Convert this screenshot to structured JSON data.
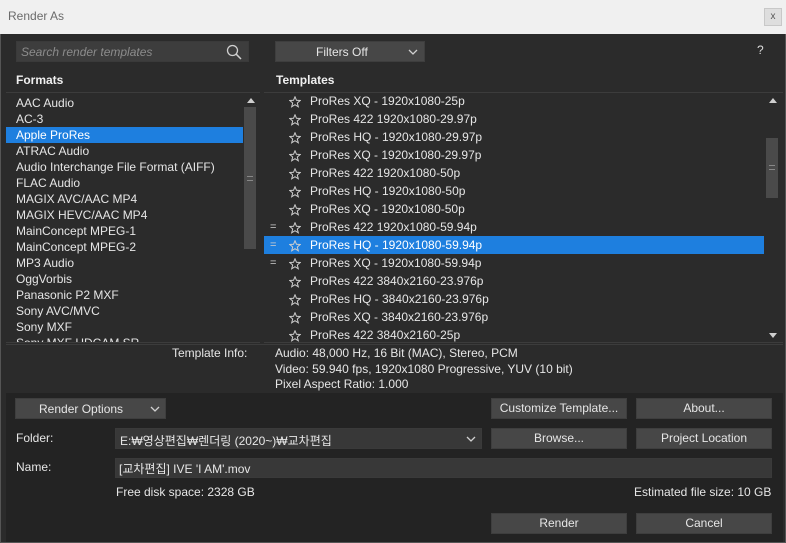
{
  "window": {
    "title": "Render As",
    "close_label": "x"
  },
  "search": {
    "placeholder": "Search render templates"
  },
  "filter": {
    "label": "Filters Off"
  },
  "help": {
    "label": "?"
  },
  "formats": {
    "header": "Formats",
    "items": [
      "AAC Audio",
      "AC-3",
      "Apple ProRes",
      "ATRAC Audio",
      "Audio Interchange File Format (AIFF)",
      "FLAC Audio",
      "MAGIX AVC/AAC MP4",
      "MAGIX HEVC/AAC MP4",
      "MainConcept MPEG-1",
      "MainConcept MPEG-2",
      "MP3 Audio",
      "OggVorbis",
      "Panasonic P2 MXF",
      "Sony AVC/MVC",
      "Sony MXF",
      "Sony MXF HDCAM SR"
    ],
    "selected_index": 2
  },
  "templates": {
    "header": "Templates",
    "items": [
      {
        "name": "ProRes XQ - 1920x1080-25p",
        "marker": ""
      },
      {
        "name": "ProRes 422 1920x1080-29.97p",
        "marker": ""
      },
      {
        "name": "ProRes HQ - 1920x1080-29.97p",
        "marker": ""
      },
      {
        "name": "ProRes XQ - 1920x1080-29.97p",
        "marker": ""
      },
      {
        "name": "ProRes 422 1920x1080-50p",
        "marker": ""
      },
      {
        "name": "ProRes HQ - 1920x1080-50p",
        "marker": ""
      },
      {
        "name": "ProRes XQ - 1920x1080-50p",
        "marker": ""
      },
      {
        "name": "ProRes 422 1920x1080-59.94p",
        "marker": "="
      },
      {
        "name": "ProRes HQ - 1920x1080-59.94p",
        "marker": "="
      },
      {
        "name": "ProRes XQ - 1920x1080-59.94p",
        "marker": "="
      },
      {
        "name": "ProRes 422 3840x2160-23.976p",
        "marker": ""
      },
      {
        "name": "ProRes HQ - 3840x2160-23.976p",
        "marker": ""
      },
      {
        "name": "ProRes XQ - 3840x2160-23.976p",
        "marker": ""
      },
      {
        "name": "ProRes 422 3840x2160-25p",
        "marker": ""
      }
    ],
    "selected_index": 8
  },
  "template_info": {
    "label": "Template Info:",
    "audio": "Audio: 48,000 Hz, 16 Bit (MAC), Stereo, PCM",
    "video": "Video: 59.940 fps, 1920x1080 Progressive, YUV (10 bit)",
    "par": "Pixel Aspect Ratio: 1.000"
  },
  "buttons": {
    "render_options": "Render Options",
    "customize": "Customize Template...",
    "about": "About...",
    "browse": "Browse...",
    "project_location": "Project Location",
    "render": "Render",
    "cancel": "Cancel"
  },
  "folder": {
    "label": "Folder:",
    "value": "E:₩영상편집₩렌더링 (2020~)₩교차편집"
  },
  "name": {
    "label": "Name:",
    "value": "[교차편집] IVE 'I AM'.mov"
  },
  "disk": {
    "free": "Free disk space: 2328 GB",
    "estimated": "Estimated file size: 10 GB"
  },
  "icons": {
    "search": "search-icon",
    "chevron": "chevron-down-icon",
    "star": "star-outline-icon",
    "close": "close-icon"
  }
}
